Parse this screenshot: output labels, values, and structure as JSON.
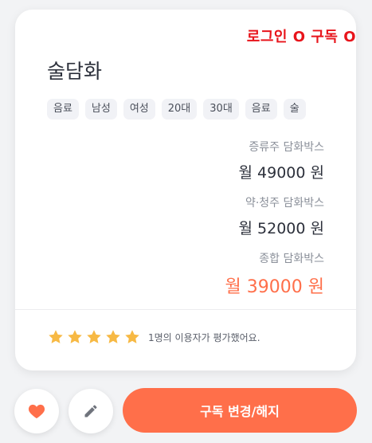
{
  "status_label": "로그인 O 구독 O",
  "product": {
    "title": "술담화",
    "tags": [
      "음료",
      "남성",
      "여성",
      "20대",
      "30대",
      "음료",
      "술"
    ]
  },
  "plans": [
    {
      "name": "증류주 담화박스",
      "price": "월 49000 원"
    },
    {
      "name": "약·청주 담화박스",
      "price": "월 52000 원"
    },
    {
      "name": "종합 담화박스",
      "price": "월 39000 원"
    }
  ],
  "rating": {
    "stars": 5,
    "max_stars": 5,
    "text": "1명의 이용자가 평가했어요."
  },
  "actions": {
    "like_icon": "heart-icon",
    "edit_icon": "pencil-icon",
    "subscribe_button": "구독 변경/해지"
  },
  "colors": {
    "accent": "#ff6f4a",
    "status": "#e8141b",
    "star": "#f7b944"
  }
}
